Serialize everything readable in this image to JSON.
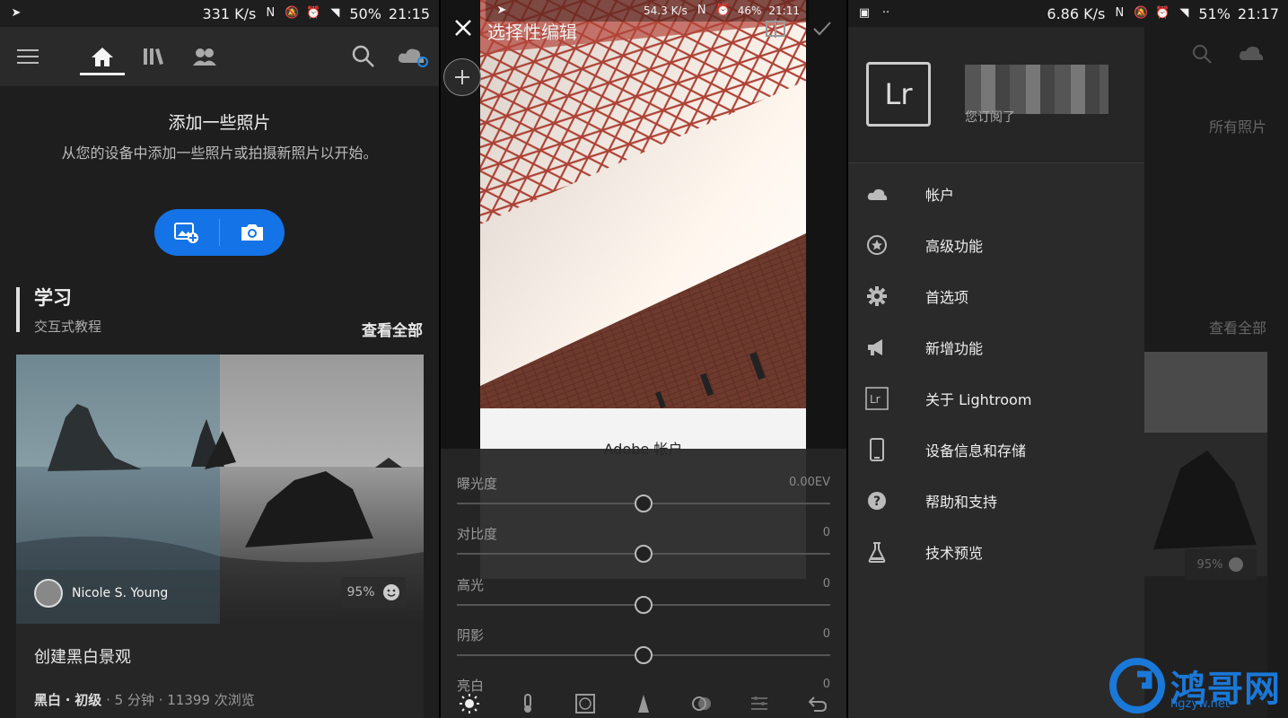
{
  "panel1": {
    "status": {
      "speed": "331 K/s",
      "battery": "50%",
      "time": "21:15"
    },
    "add_title": "添加一些照片",
    "add_subtitle": "从您的设备中添加一些照片或拍摄新照片以开始。",
    "learn": {
      "title": "学习",
      "subtitle": "交互式教程",
      "view_all": "查看全部"
    },
    "card": {
      "author": "Nicole S. Young",
      "percent": "95%",
      "title": "创建黑白景观",
      "meta_tag1": "黑白",
      "meta_sep": "·",
      "meta_tag2": "初级",
      "meta_rest": "· 5 分钟 · 11399 次浏览"
    }
  },
  "panel2": {
    "status": {
      "speed": "54.3 K/s",
      "battery": "46%",
      "time": "21:11"
    },
    "title": "选择性编辑",
    "adobe_title": "Adobe 帐户",
    "sliders": [
      {
        "label": "曝光度",
        "value": "0.00EV"
      },
      {
        "label": "对比度",
        "value": "0"
      },
      {
        "label": "高光",
        "value": "0"
      },
      {
        "label": "阴影",
        "value": "0"
      },
      {
        "label": "亮白",
        "value": "0"
      }
    ]
  },
  "panel3": {
    "status": {
      "speed": "6.86 K/s",
      "battery": "51%",
      "time": "21:17"
    },
    "logo": "Lr",
    "subscription": "您订阅了",
    "menu": [
      {
        "label": "帐户",
        "icon": "cloud-icon"
      },
      {
        "label": "高级功能",
        "icon": "star-icon"
      },
      {
        "label": "首选项",
        "icon": "gear-icon"
      },
      {
        "label": "新增功能",
        "icon": "megaphone-icon"
      },
      {
        "label": "关于 Lightroom",
        "icon": "lr-icon"
      },
      {
        "label": "设备信息和存储",
        "icon": "phone-icon"
      },
      {
        "label": "帮助和支持",
        "icon": "help-icon"
      },
      {
        "label": "技术预览",
        "icon": "flask-icon"
      }
    ],
    "bg_all_photos": "所有照片",
    "bg_view_all": "查看全部",
    "bg_percent": "95%"
  },
  "watermark": {
    "text": "鸿哥网",
    "url": "hgzyw.net"
  },
  "colors": {
    "accent": "#1473e6",
    "watermark": "#1a78d8"
  }
}
